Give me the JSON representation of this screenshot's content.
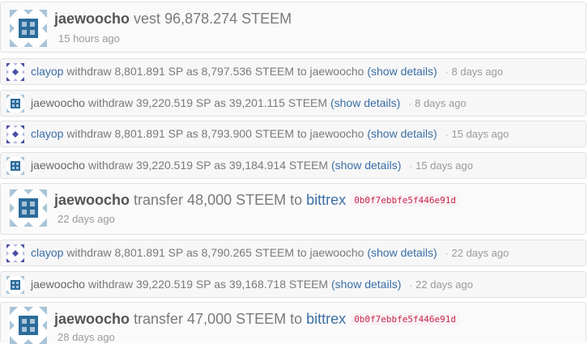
{
  "entries": [
    {
      "kind": "vest",
      "user": "jaewoocho",
      "verb": "vest",
      "amount": "96,878.274 STEEM",
      "time": "15 hours ago",
      "avatar": "identicon-blue"
    },
    {
      "kind": "withdraw",
      "user": "clayop",
      "text": "withdraw 8,801.891 SP as 8,797.536 STEEM to jaewoocho",
      "details": "(show details)",
      "time": "8 days ago",
      "avatar": "identicon-purple"
    },
    {
      "kind": "withdraw",
      "user": "jaewoocho",
      "text": "withdraw 39,220.519 SP as 39,201.115 STEEM",
      "details": "(show details)",
      "time": "8 days ago",
      "avatar": "identicon-blue"
    },
    {
      "kind": "withdraw",
      "user": "clayop",
      "text": "withdraw 8,801.891 SP as 8,793.900 STEEM to jaewoocho",
      "details": "(show details)",
      "time": "15 days ago",
      "avatar": "identicon-purple"
    },
    {
      "kind": "withdraw",
      "user": "jaewoocho",
      "text": "withdraw 39,220.519 SP as 39,184.914 STEEM",
      "details": "(show details)",
      "time": "15 days ago",
      "avatar": "identicon-blue"
    },
    {
      "kind": "transfer",
      "user": "jaewoocho",
      "text": "transfer 48,000 STEEM to",
      "to": "bittrex",
      "memo": "0b0f7ebbfe5f446e91d",
      "time": "22 days ago",
      "avatar": "identicon-blue"
    },
    {
      "kind": "withdraw",
      "user": "clayop",
      "text": "withdraw 8,801.891 SP as 8,790.265 STEEM to jaewoocho",
      "details": "(show details)",
      "time": "22 days ago",
      "avatar": "identicon-purple"
    },
    {
      "kind": "withdraw",
      "user": "jaewoocho",
      "text": "withdraw 39,220.519 SP as 39,168.718 STEEM",
      "details": "(show details)",
      "time": "22 days ago",
      "avatar": "identicon-blue"
    },
    {
      "kind": "transfer",
      "user": "jaewoocho",
      "text": "transfer 47,000 STEEM to",
      "to": "bittrex",
      "memo": "0b0f7ebbfe5f446e91d",
      "time": "28 days ago",
      "avatar": "identicon-blue"
    }
  ],
  "colors": {
    "identicon_blue": "#2b6c9a",
    "identicon_blue_light": "#a9c4d8",
    "identicon_purple": "#4a4fa5",
    "identicon_purple_light": "#b7b9e0",
    "link": "#3b6ea5",
    "memo": "#c7254e"
  }
}
